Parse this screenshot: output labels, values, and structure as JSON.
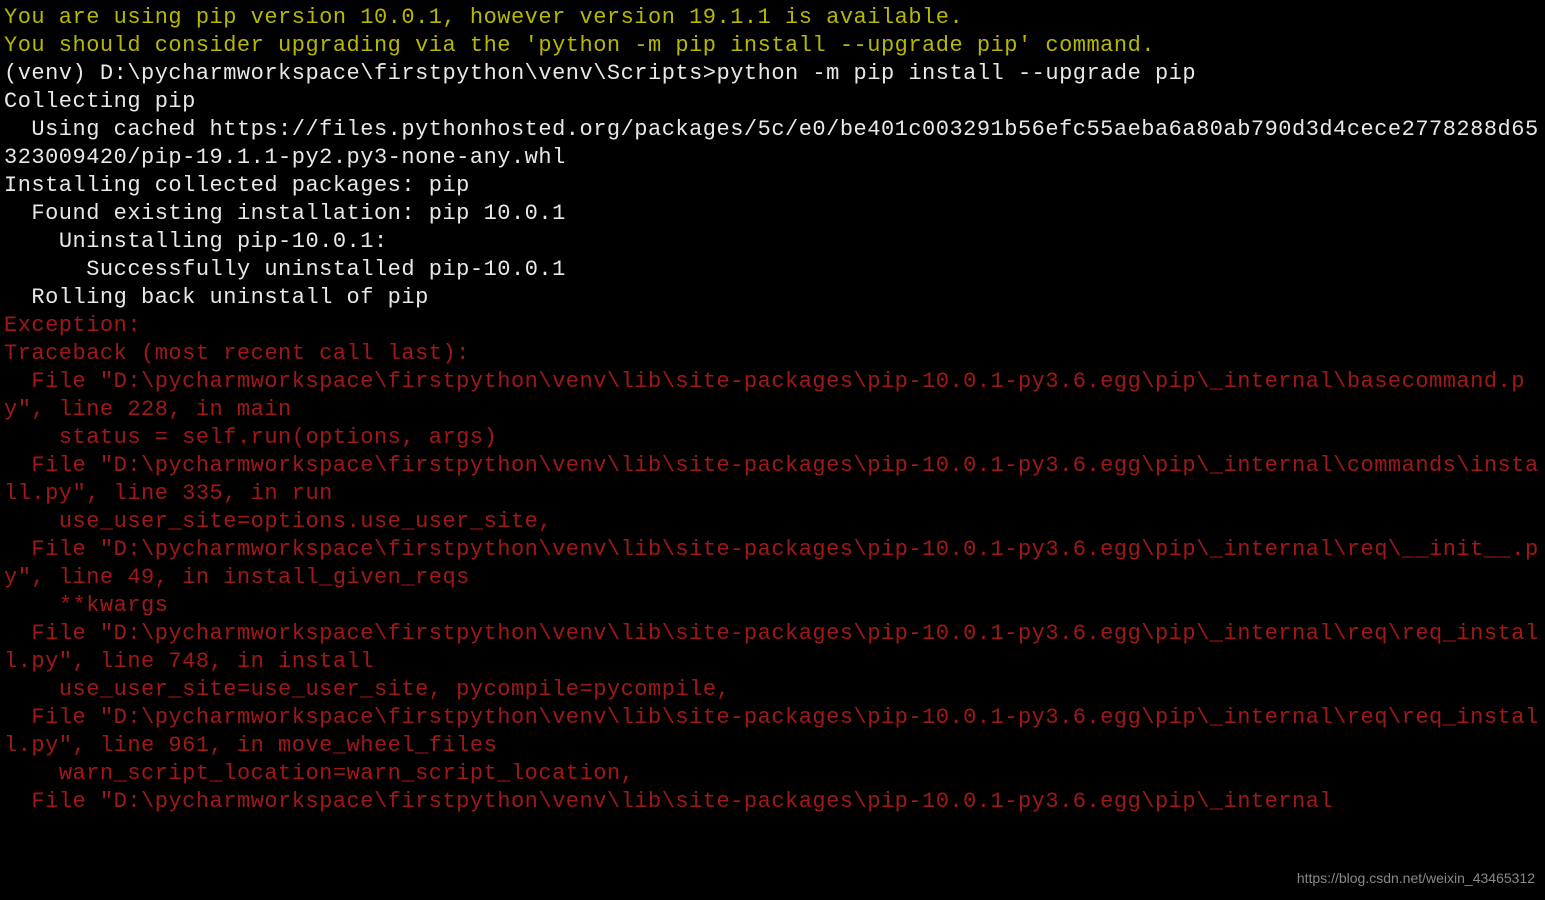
{
  "terminal": {
    "warning_lines": [
      "You are using pip version 10.0.1, however version 19.1.1 is available.",
      "You should consider upgrading via the 'python -m pip install --upgrade pip' command."
    ],
    "blank_line": "",
    "prompt_line": "(venv) D:\\pycharmworkspace\\firstpython\\venv\\Scripts>python -m pip install --upgrade pip",
    "progress_lines": [
      "Collecting pip",
      "  Using cached https://files.pythonhosted.org/packages/5c/e0/be401c003291b56efc55aeba6a80ab790d3d4cece2778288d65323009420/pip-19.1.1-py2.py3-none-any.whl",
      "Installing collected packages: pip",
      "  Found existing installation: pip 10.0.1",
      "    Uninstalling pip-10.0.1:",
      "      Successfully uninstalled pip-10.0.1",
      "  Rolling back uninstall of pip"
    ],
    "error_lines": [
      "Exception:",
      "Traceback (most recent call last):",
      "  File \"D:\\pycharmworkspace\\firstpython\\venv\\lib\\site-packages\\pip-10.0.1-py3.6.egg\\pip\\_internal\\basecommand.py\", line 228, in main",
      "    status = self.run(options, args)",
      "  File \"D:\\pycharmworkspace\\firstpython\\venv\\lib\\site-packages\\pip-10.0.1-py3.6.egg\\pip\\_internal\\commands\\install.py\", line 335, in run",
      "    use_user_site=options.use_user_site,",
      "  File \"D:\\pycharmworkspace\\firstpython\\venv\\lib\\site-packages\\pip-10.0.1-py3.6.egg\\pip\\_internal\\req\\__init__.py\", line 49, in install_given_reqs",
      "    **kwargs",
      "  File \"D:\\pycharmworkspace\\firstpython\\venv\\lib\\site-packages\\pip-10.0.1-py3.6.egg\\pip\\_internal\\req\\req_install.py\", line 748, in install",
      "    use_user_site=use_user_site, pycompile=pycompile,",
      "  File \"D:\\pycharmworkspace\\firstpython\\venv\\lib\\site-packages\\pip-10.0.1-py3.6.egg\\pip\\_internal\\req\\req_install.py\", line 961, in move_wheel_files",
      "    warn_script_location=warn_script_location,",
      "  File \"D:\\pycharmworkspace\\firstpython\\venv\\lib\\site-packages\\pip-10.0.1-py3.6.egg\\pip\\_internal"
    ]
  },
  "watermark": "https://blog.csdn.net/weixin_43465312"
}
